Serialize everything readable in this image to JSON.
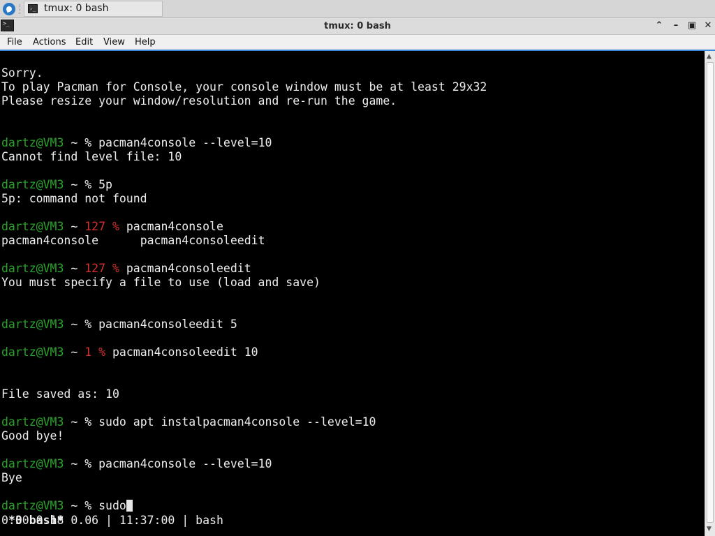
{
  "taskbar": {
    "task_label": "tmux: 0 bash"
  },
  "window": {
    "title": "tmux: 0 bash",
    "icons": [
      "start-menu-icon",
      "terminal-icon",
      "chevron-up-icon",
      "minimize-icon",
      "maximize-icon",
      "close-icon"
    ]
  },
  "menu": {
    "file": "File",
    "actions": "Actions",
    "edit": "Edit",
    "view": "View",
    "help": "Help"
  },
  "terminal": {
    "user": "dartz@VM3",
    "lines": {
      "l0": "Sorry.",
      "l1": "To play Pacman for Console, your console window must be at least 29x32",
      "l2": "Please resize your window/resolution and re-run the game.",
      "p1_cmd": "% pacman4console --level=10",
      "o1": "Cannot find level file: 10",
      "p2_cmd": "% 5p",
      "o2": "5p: command not found",
      "p3_code": "127 %",
      "p3_cmd": "pacman4console",
      "o3a": "pacman4console",
      "o3b": "pacman4consoleedit",
      "p4_code": "127 %",
      "p4_cmd": "pacman4consoleedit",
      "o4": "You must specify a file to use (load and save)",
      "p5_cmd": "% pacman4consoleedit 5",
      "p6_code": "1 %",
      "p6_cmd": "pacman4consoleedit 10",
      "o6": "File saved as: 10",
      "p7_cmd": "% sudo apt instalpacman4console --level=10",
      "o7": "Good bye!",
      "p8_cmd": "% pacman4console --level=10",
      "o8": "Bye",
      "p9_cmd": "% sudo"
    },
    "status_left": "*0 bash*",
    "status_right": "0.30 0.18 0.06 | 11:37:00 | bash"
  },
  "colors": {
    "prompt_user": "#2aa32a",
    "exit_code": "#d32f2f",
    "accent": "#3a86d6"
  }
}
